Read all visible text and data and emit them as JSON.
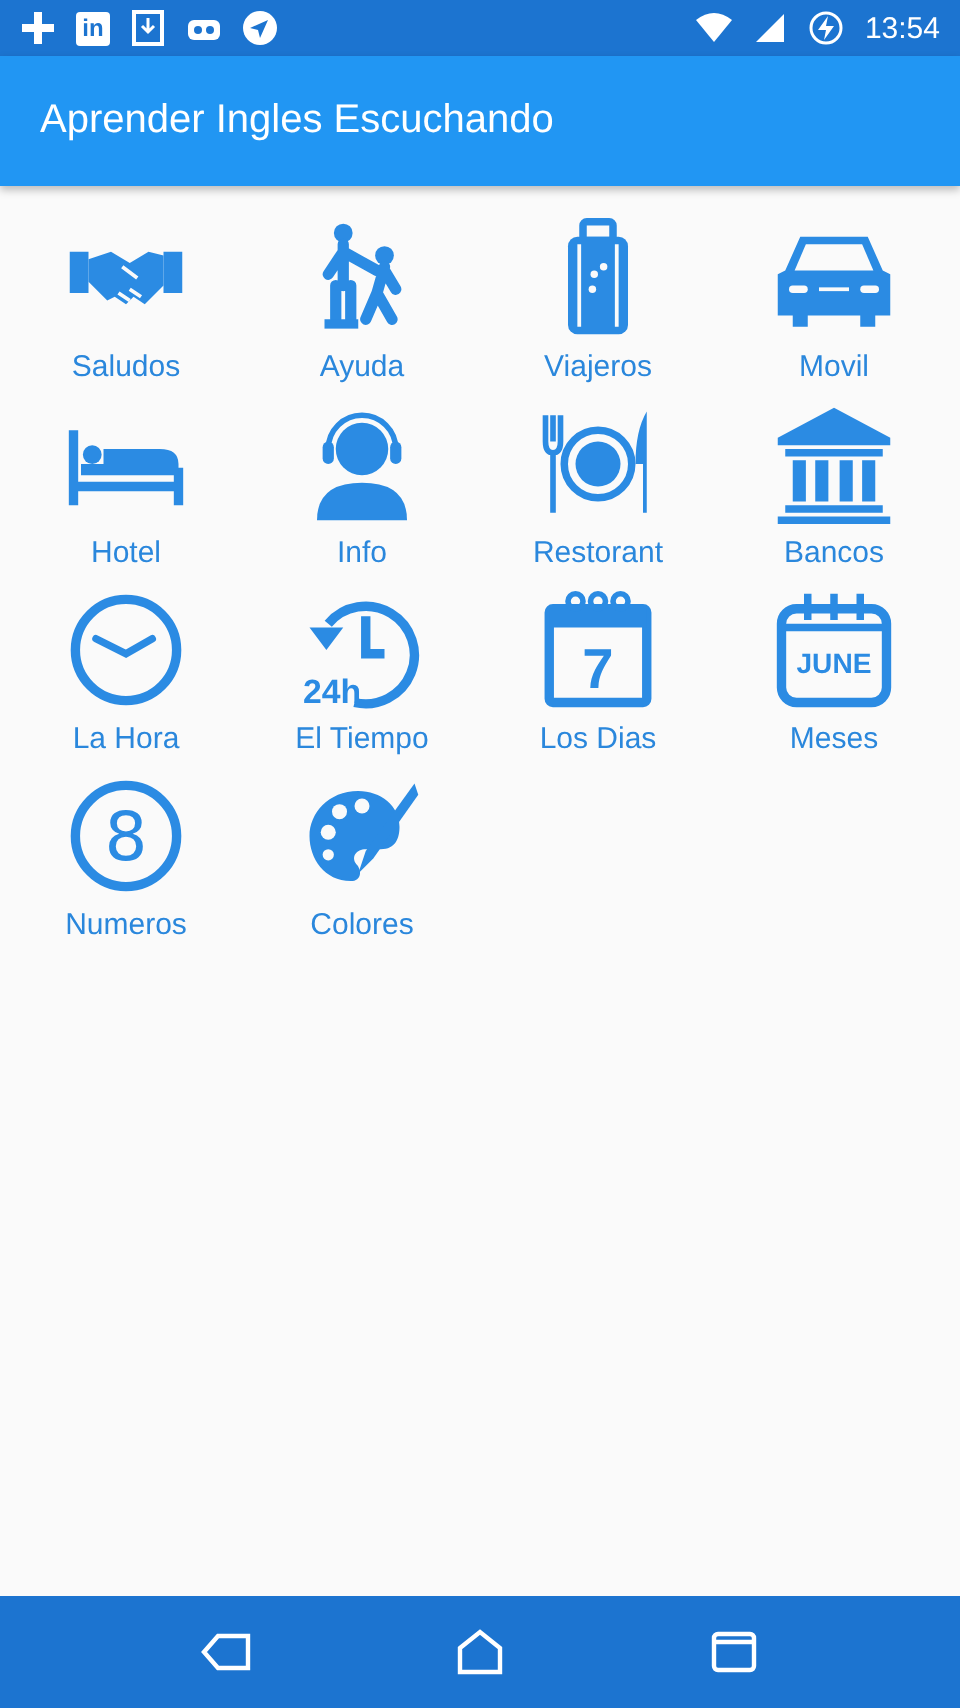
{
  "status_bar": {
    "linkedin_text": "in",
    "time": "13:54"
  },
  "app_bar": {
    "title": "Aprender Ingles Escuchando"
  },
  "categories": [
    {
      "label": "Saludos",
      "kind": "handshake"
    },
    {
      "label": "Ayuda",
      "kind": "helping"
    },
    {
      "label": "Viajeros",
      "kind": "luggage"
    },
    {
      "label": "Movil",
      "kind": "car"
    },
    {
      "label": "Hotel",
      "kind": "bed"
    },
    {
      "label": "Info",
      "kind": "headset"
    },
    {
      "label": "Restorant",
      "kind": "dining"
    },
    {
      "label": "Bancos",
      "kind": "bank"
    },
    {
      "label": "La Hora",
      "kind": "clock"
    },
    {
      "label": "El Tiempo",
      "kind": "history",
      "icon_text": "24h"
    },
    {
      "label": "Los Dias",
      "kind": "calendar",
      "icon_text": "7"
    },
    {
      "label": "Meses",
      "kind": "calendar-month",
      "icon_text": "JUNE"
    },
    {
      "label": "Numeros",
      "kind": "number",
      "icon_text": "8"
    },
    {
      "label": "Colores",
      "kind": "palette"
    }
  ]
}
